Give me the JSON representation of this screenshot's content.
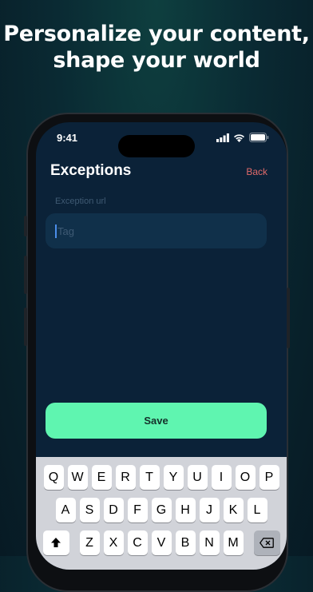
{
  "headline": {
    "line1": "Personalize your content,",
    "line2": "shape your world"
  },
  "status_bar": {
    "time": "9:41"
  },
  "nav": {
    "title": "Exceptions",
    "back_label": "Back"
  },
  "form": {
    "field_label": "Exception url",
    "tag_placeholder": "Tag",
    "save_label": "Save"
  },
  "keyboard": {
    "row1": [
      "Q",
      "W",
      "E",
      "R",
      "T",
      "Y",
      "U",
      "I",
      "O",
      "P"
    ],
    "row2": [
      "A",
      "S",
      "D",
      "F",
      "G",
      "H",
      "J",
      "K",
      "L"
    ],
    "row3": [
      "Z",
      "X",
      "C",
      "V",
      "B",
      "N",
      "M"
    ],
    "shift_icon": "shift-arrow-icon",
    "delete_icon": "backspace-icon"
  },
  "colors": {
    "accent": "#5ff5b0",
    "back": "#e06a6a",
    "screen_bg": "#0b2238"
  }
}
